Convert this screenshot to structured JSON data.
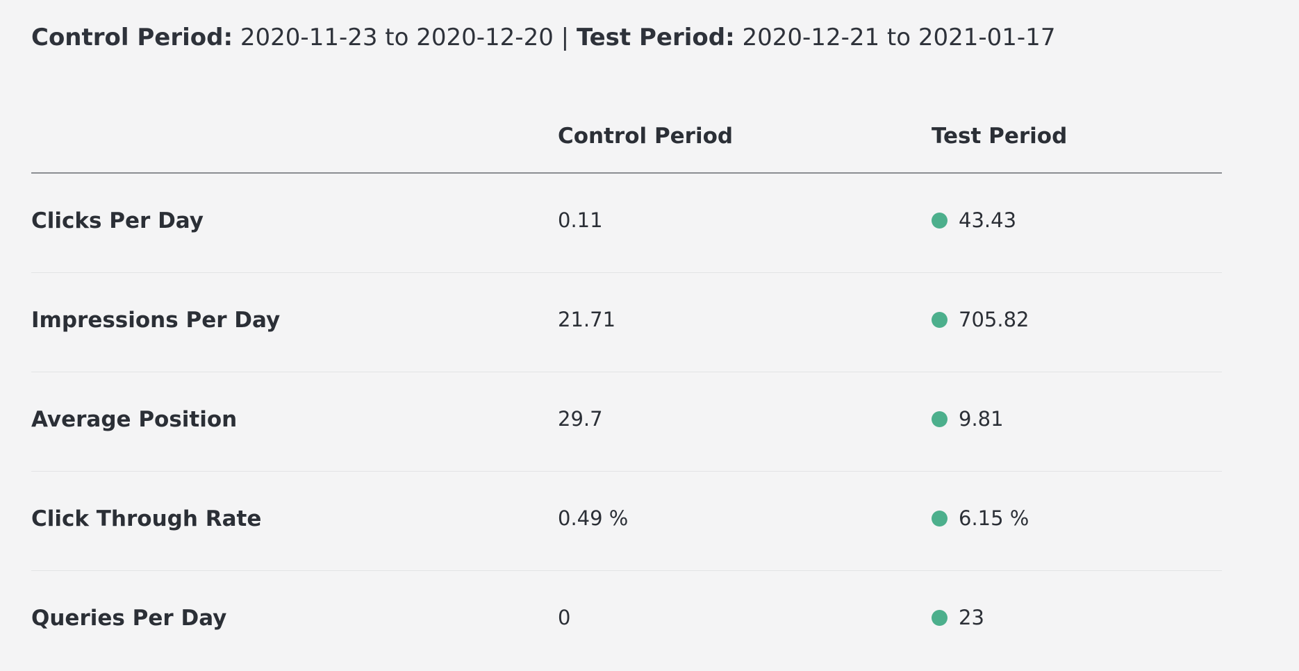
{
  "header": {
    "control_label": "Control Period:",
    "control_range": "2020-11-23 to 2020-12-20",
    "separator": "|",
    "test_label": "Test Period:",
    "test_range": "2020-12-21 to 2021-01-17"
  },
  "table": {
    "columns": [
      "",
      "Control Period",
      "Test Period"
    ],
    "indicator_color": "#4caf8c",
    "rows": [
      {
        "metric": "Clicks Per Day",
        "control": "0.11",
        "test": "43.43"
      },
      {
        "metric": "Impressions Per Day",
        "control": "21.71",
        "test": "705.82"
      },
      {
        "metric": "Average Position",
        "control": "29.7",
        "test": "9.81"
      },
      {
        "metric": "Click Through Rate",
        "control": "0.49 %",
        "test": "6.15 %"
      },
      {
        "metric": "Queries Per Day",
        "control": "0",
        "test": "23"
      }
    ]
  }
}
